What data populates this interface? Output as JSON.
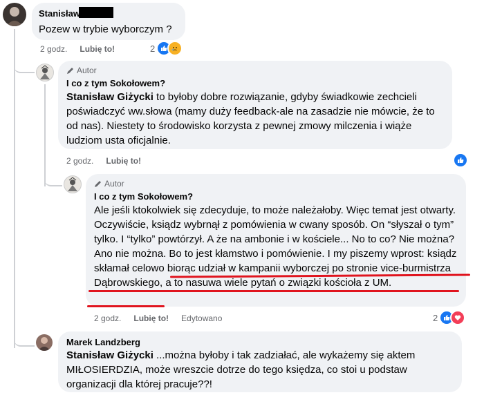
{
  "comments": [
    {
      "author": "Stanisław",
      "text": "Pozew w trybie wyborczym ?",
      "time": "2 godz.",
      "like_label": "Lubię to!",
      "reaction_count": "2"
    },
    {
      "badge": "Autor",
      "group": "I co z tym Sokołowem?",
      "mention": "Stanisław Giżycki",
      "text": " to byłoby dobre rozwiązanie, gdyby świadkowie zechcieli poświadczyć ww.słowa (mamy duży feedback-ale na zasadzie nie mówcie, że to od nas). Niestety to środowisko korzysta z pewnej zmowy milczenia i wiąże ludziom usta oficjalnie.",
      "time": "2 godz.",
      "like_label": "Lubię to!"
    },
    {
      "badge": "Autor",
      "group": "I co z tym Sokołowem?",
      "text_plain": "Ale jeśli ktokolwiek się zdecyduje, to może należałoby. Więc temat jest otwarty. Oczywiście, ksiądz wybrnął z pomówienia w cwany sposób. On “słyszał o tym” tylko. I “tylko” powtórzył. A że na ambonie i w kościele... No to co? Nie można? Ano nie można. Bo to jest kłamstwo i pomówienie. I my piszemy wprost: ",
      "text_underlined": "ksiądz skłamał celowo biorąc udział w kampanii wyborczej po stronie vice-burmistrza Dąbrowskiego, a to nasuwa wiele pytań o związki kościoła z UM.",
      "time": "2 godz.",
      "like_label": "Lubię to!",
      "edited_label": "Edytowano",
      "reaction_count": "2"
    },
    {
      "author": "Marek Landzberg",
      "mention": "Stanisław Giżycki",
      "text": " ...można byłoby i tak zadziałać, ale wykażemy się aktem MIŁOSIERDZIA, może wreszcie dotrze do tego księdza, co stoi u podstaw organizacji dla której pracuje??!"
    }
  ],
  "icons": {
    "badge": "pen-icon",
    "like_reaction": "like-reaction-icon",
    "sad_reaction": "sad-reaction-icon",
    "love_reaction": "love-reaction-icon"
  },
  "colors": {
    "bubble": "#f0f2f5",
    "like_blue": "#1877f2",
    "annotation_red": "#e0141e"
  }
}
